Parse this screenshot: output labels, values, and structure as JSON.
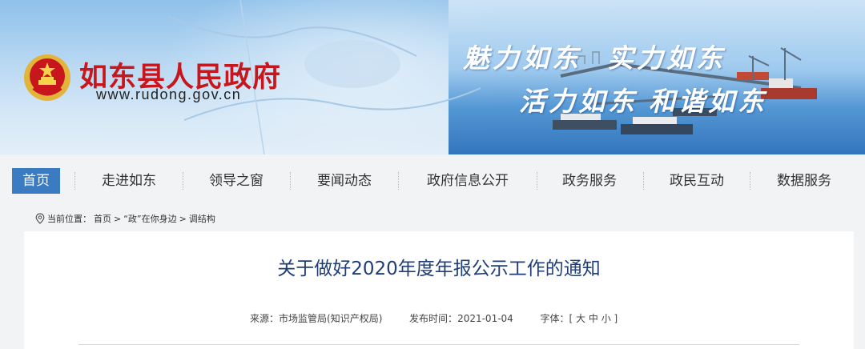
{
  "header": {
    "site_name": "如东县人民政府",
    "site_url": "www.rudong.gov.cn",
    "slogans": [
      "魅力如东",
      "实力如东",
      "活力如东",
      "和谐如东"
    ]
  },
  "nav": {
    "items": [
      {
        "label": "首页",
        "active": true
      },
      {
        "label": "走进如东"
      },
      {
        "label": "领导之窗"
      },
      {
        "label": "要闻动态"
      },
      {
        "label": "政府信息公开"
      },
      {
        "label": "政务服务"
      },
      {
        "label": "政民互动"
      },
      {
        "label": "数据服务"
      }
    ]
  },
  "breadcrumb": {
    "prefix": "当前位置：",
    "items": [
      "首页",
      "“政”在你身边",
      "调结构"
    ],
    "separator": ">"
  },
  "article": {
    "title": "关于做好2020年度年报公示工作的通知",
    "source_label": "来源：",
    "source": "市场监管局(知识产权局)",
    "date_label": "发布时间：",
    "date": "2021-01-04",
    "font_label": "字体：",
    "font_open": "[",
    "font_large": "大",
    "font_medium": "中",
    "font_small": "小",
    "font_close": "]"
  },
  "colors": {
    "brand_red": "#c8161d",
    "nav_active": "#3a7bc2",
    "title_blue": "#1f3e78"
  }
}
